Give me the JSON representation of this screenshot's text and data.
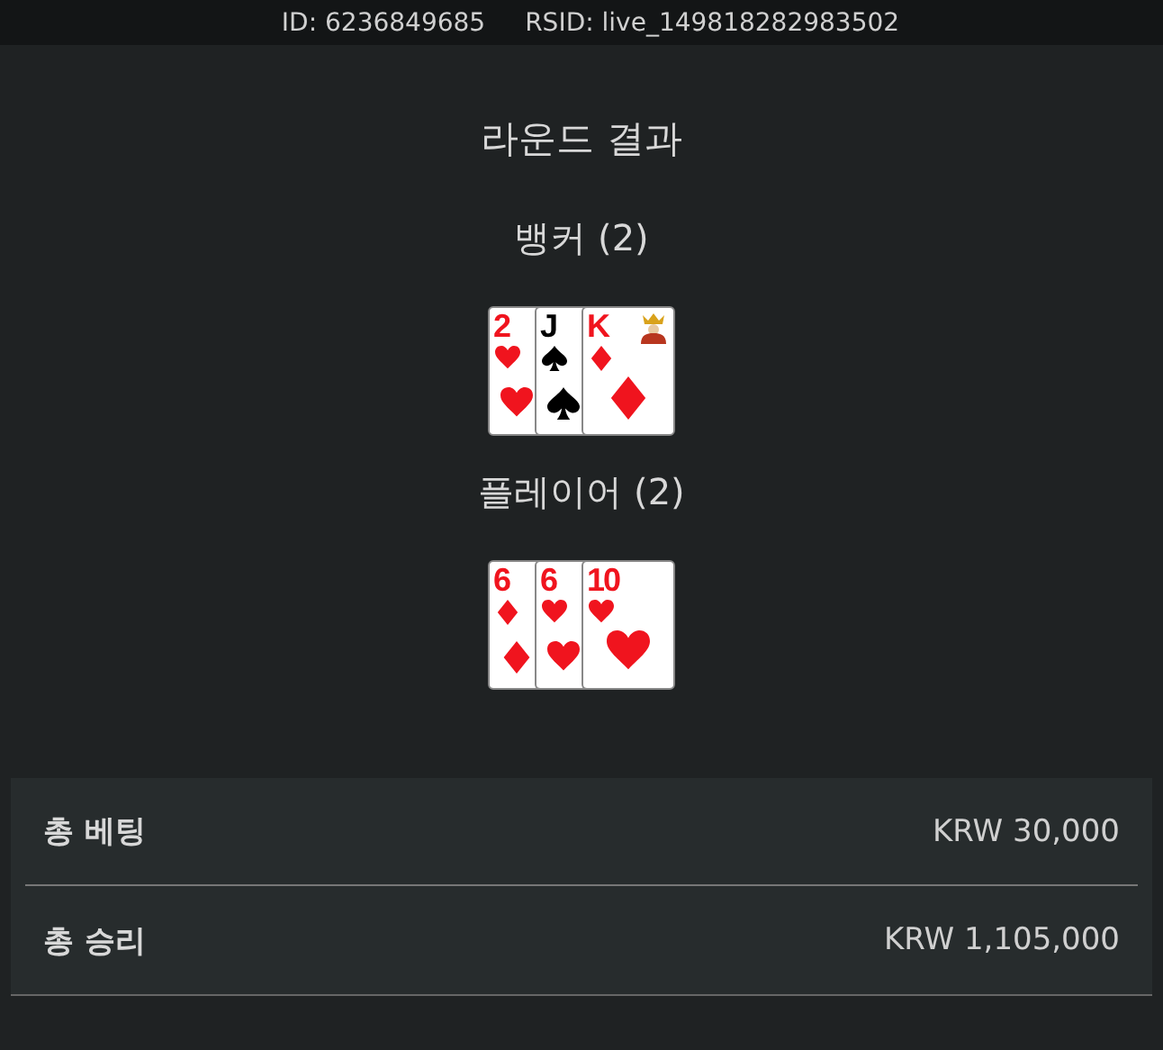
{
  "top_bar": {
    "id_label": "ID: 6236849685",
    "rsid_label": "RSID: live_149818282983502"
  },
  "title": "라운드 결과",
  "hands": [
    {
      "name": "뱅커 (2)",
      "cards": [
        {
          "rank": "2",
          "kind": "heart",
          "picture": false
        },
        {
          "rank": "J",
          "kind": "spade",
          "picture": false
        },
        {
          "rank": "K",
          "kind": "diamond",
          "picture": true
        }
      ]
    },
    {
      "name": "플레이어 (2)",
      "cards": [
        {
          "rank": "6",
          "kind": "diamond",
          "picture": false
        },
        {
          "rank": "6",
          "kind": "heart",
          "picture": false
        },
        {
          "rank": "10",
          "kind": "heart",
          "picture": false
        }
      ]
    }
  ],
  "summary": [
    {
      "label": "총 베팅",
      "value": "KRW 30,000"
    },
    {
      "label": "총 승리",
      "value": "KRW 1,105,000"
    }
  ]
}
